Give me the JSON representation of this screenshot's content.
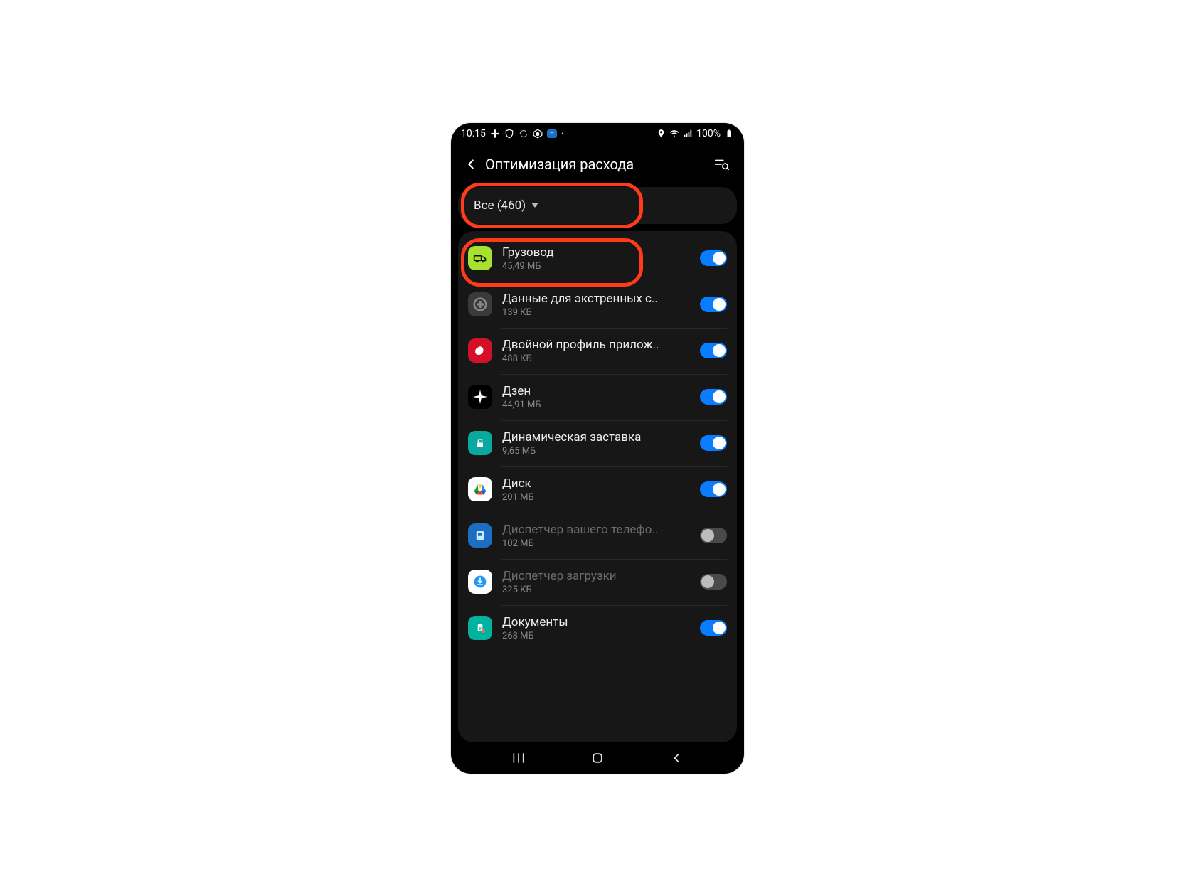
{
  "statusbar": {
    "time": "10:15",
    "battery_text": "100%"
  },
  "header": {
    "title": "Оптимизация расхода"
  },
  "filter": {
    "label": "Все (460)"
  },
  "apps": [
    {
      "name": "Грузовод",
      "size": "45,49 МБ",
      "enabled": true,
      "highlight": true,
      "icon": "truck",
      "icon_bg": "#a6e22e",
      "icon_fg": "#111"
    },
    {
      "name": "Данные для экстренных с..",
      "size": "139 КБ",
      "enabled": true,
      "icon": "plus",
      "icon_bg": "#3a3a3a",
      "icon_fg": "#888"
    },
    {
      "name": "Двойной профиль прилож..",
      "size": "488 КБ",
      "enabled": true,
      "icon": "blob",
      "icon_bg": "#d31027",
      "icon_fg": "#fff"
    },
    {
      "name": "Дзен",
      "size": "44,91 МБ",
      "enabled": true,
      "icon": "star4",
      "icon_bg": "#000",
      "icon_fg": "#fff"
    },
    {
      "name": "Динамическая заставка",
      "size": "9,65 МБ",
      "enabled": true,
      "icon": "lock",
      "icon_bg": "#0aa9a0",
      "icon_fg": "#fff"
    },
    {
      "name": "Диск",
      "size": "201 МБ",
      "enabled": true,
      "icon": "drive",
      "icon_bg": "#fff",
      "icon_fg": "#0f9d58"
    },
    {
      "name": "Диспетчер вашего телефо..",
      "size": "102 МБ",
      "enabled": false,
      "icon": "phone-mgr",
      "icon_bg": "#1b6ec2",
      "icon_fg": "#cfe8ff"
    },
    {
      "name": "Диспетчер загрузки",
      "size": "325 КБ",
      "enabled": false,
      "icon": "download",
      "icon_bg": "#fff",
      "icon_fg": "#2196f3"
    },
    {
      "name": "Документы",
      "size": "268 МБ",
      "enabled": true,
      "icon": "docs",
      "icon_bg": "#00b3a1",
      "icon_fg": "#fff"
    }
  ]
}
